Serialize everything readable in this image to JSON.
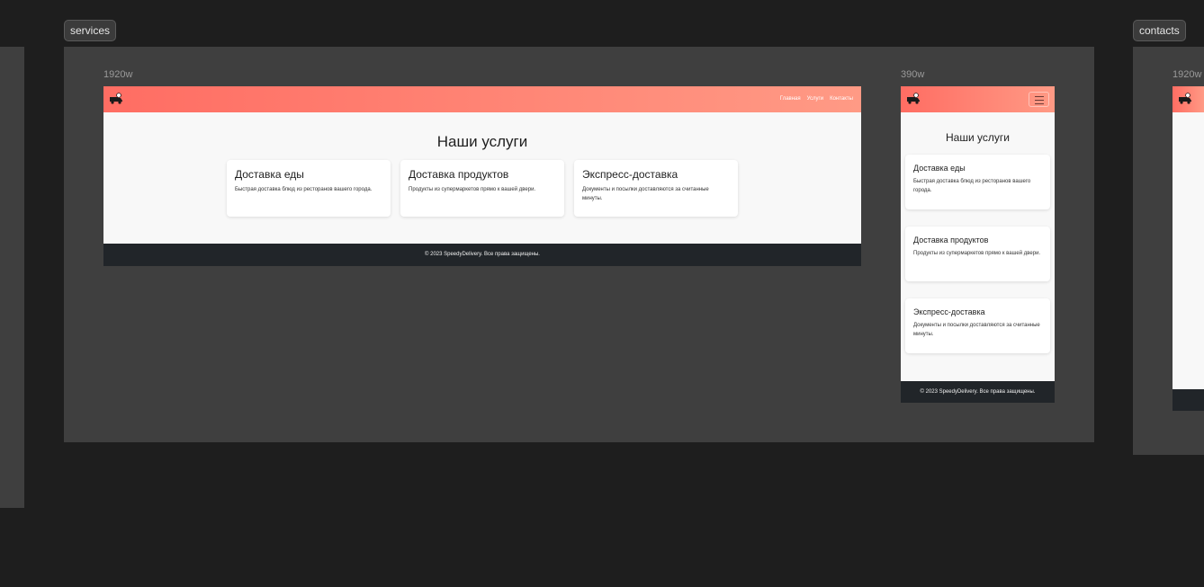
{
  "boards": {
    "services": {
      "label": "services"
    },
    "contacts": {
      "label": "contacts",
      "width_label": "1920w"
    }
  },
  "desktop": {
    "width_label": "1920w",
    "nav": [
      "Главная",
      "Услуги",
      "Контакты"
    ],
    "title": "Наши услуги",
    "cards": [
      {
        "title": "Доставка еды",
        "text": "Быстрая доставка блюд из ресторанов вашего города."
      },
      {
        "title": "Доставка продуктов",
        "text": "Продукты из супермаркетов прямо к вашей двери."
      },
      {
        "title": "Экспресс-доставка",
        "text": "Документы и посылки доставляются за считанные минуты."
      }
    ],
    "footer": "© 2023 SpeedyDelivery. Все права защищены."
  },
  "mobile": {
    "width_label": "390w",
    "title": "Наши услуги",
    "cards": [
      {
        "title": "Доставка еды",
        "text": "Быстрая доставка блюд из ресторанов вашего города."
      },
      {
        "title": "Доставка продуктов",
        "text": "Продукты из супермаркетов прямо к вашей двери."
      },
      {
        "title": "Экспресс-доставка",
        "text": "Документы и посылки доставляются за считанные минуты."
      }
    ],
    "footer": "© 2023 SpeedyDelivery. Все права защищены."
  },
  "colors": {
    "canvas": "#1e1e1e",
    "board": "#3f3f3f",
    "navbar_start": "#ff6d63",
    "navbar_end": "#ff9a85",
    "footer": "#212529"
  }
}
